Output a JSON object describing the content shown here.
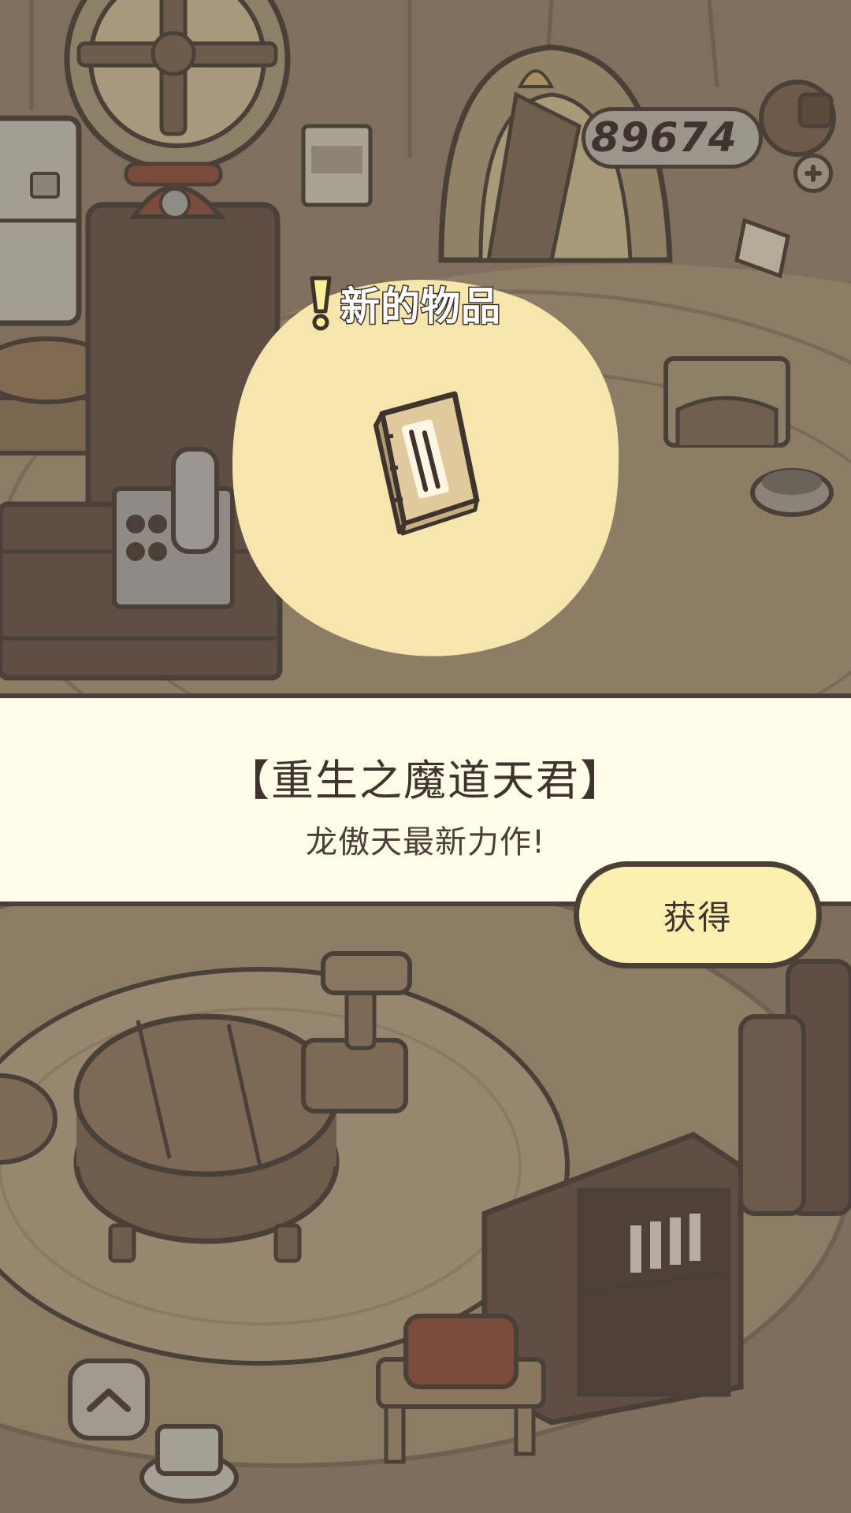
{
  "hud": {
    "coins": "89674",
    "add_icon": "plus-icon"
  },
  "popup": {
    "title": "新的物品",
    "title_icon": "exclamation-icon",
    "item_icon": "book-icon",
    "glow_color": "#f6e6ad"
  },
  "item": {
    "name": "【重生之魔道天君】",
    "description": "龙傲天最新力作!"
  },
  "actions": {
    "obtain_label": "获得",
    "expand_icon": "chevron-up-icon"
  },
  "colors": {
    "banner_bg": "#fffde9",
    "button_bg": "#fcefb0",
    "outline": "#4b4038"
  }
}
